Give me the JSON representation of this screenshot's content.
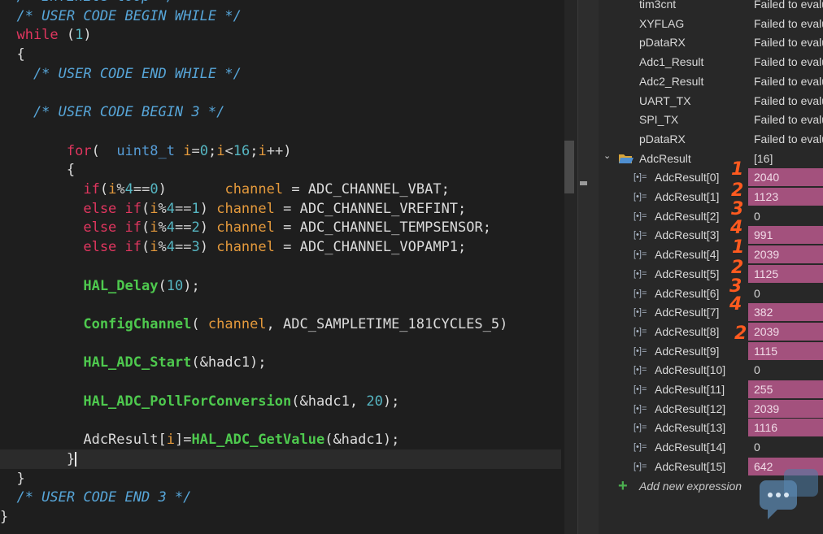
{
  "editor": {
    "lines": [
      [
        {
          "c": "cm",
          "t": "  /* Infinite loop */"
        }
      ],
      [
        {
          "c": "cm",
          "t": "  /* USER CODE BEGIN WHILE */"
        }
      ],
      [
        {
          "c": "kw",
          "t": "  while"
        },
        {
          "c": "pl",
          "t": " ("
        },
        {
          "c": "num",
          "t": "1"
        },
        {
          "c": "pl",
          "t": ")"
        }
      ],
      [
        {
          "c": "pl",
          "t": "  {"
        }
      ],
      [
        {
          "c": "cm",
          "t": "    /* USER CODE END WHILE */"
        }
      ],
      [],
      [
        {
          "c": "cm",
          "t": "    /* USER CODE BEGIN 3 */"
        }
      ],
      [],
      [
        {
          "c": "kw",
          "t": "        for"
        },
        {
          "c": "pl",
          "t": "(  "
        },
        {
          "c": "ty",
          "t": "uint8_t"
        },
        {
          "c": "pl",
          "t": " "
        },
        {
          "c": "var",
          "t": "i"
        },
        {
          "c": "op",
          "t": "="
        },
        {
          "c": "num",
          "t": "0"
        },
        {
          "c": "pl",
          "t": ";"
        },
        {
          "c": "var",
          "t": "i"
        },
        {
          "c": "op",
          "t": "<"
        },
        {
          "c": "num",
          "t": "16"
        },
        {
          "c": "pl",
          "t": ";"
        },
        {
          "c": "var",
          "t": "i"
        },
        {
          "c": "op",
          "t": "++"
        },
        {
          "c": "pl",
          "t": ")"
        }
      ],
      [
        {
          "c": "pl",
          "t": "        {"
        }
      ],
      [
        {
          "c": "kw",
          "t": "          if"
        },
        {
          "c": "pl",
          "t": "("
        },
        {
          "c": "var",
          "t": "i"
        },
        {
          "c": "op",
          "t": "%"
        },
        {
          "c": "num",
          "t": "4"
        },
        {
          "c": "op",
          "t": "=="
        },
        {
          "c": "num",
          "t": "0"
        },
        {
          "c": "pl",
          "t": ")       "
        },
        {
          "c": "var",
          "t": "channel"
        },
        {
          "c": "pl",
          "t": " = ADC_CHANNEL_VBAT;"
        }
      ],
      [
        {
          "c": "kw",
          "t": "          else if"
        },
        {
          "c": "pl",
          "t": "("
        },
        {
          "c": "var",
          "t": "i"
        },
        {
          "c": "op",
          "t": "%"
        },
        {
          "c": "num",
          "t": "4"
        },
        {
          "c": "op",
          "t": "=="
        },
        {
          "c": "num",
          "t": "1"
        },
        {
          "c": "pl",
          "t": ") "
        },
        {
          "c": "var",
          "t": "channel"
        },
        {
          "c": "pl",
          "t": " = ADC_CHANNEL_VREFINT;"
        }
      ],
      [
        {
          "c": "kw",
          "t": "          else if"
        },
        {
          "c": "pl",
          "t": "("
        },
        {
          "c": "var",
          "t": "i"
        },
        {
          "c": "op",
          "t": "%"
        },
        {
          "c": "num",
          "t": "4"
        },
        {
          "c": "op",
          "t": "=="
        },
        {
          "c": "num",
          "t": "2"
        },
        {
          "c": "pl",
          "t": ") "
        },
        {
          "c": "var",
          "t": "channel"
        },
        {
          "c": "pl",
          "t": " = ADC_CHANNEL_TEMPSENSOR;"
        }
      ],
      [
        {
          "c": "kw",
          "t": "          else if"
        },
        {
          "c": "pl",
          "t": "("
        },
        {
          "c": "var",
          "t": "i"
        },
        {
          "c": "op",
          "t": "%"
        },
        {
          "c": "num",
          "t": "4"
        },
        {
          "c": "op",
          "t": "=="
        },
        {
          "c": "num",
          "t": "3"
        },
        {
          "c": "pl",
          "t": ") "
        },
        {
          "c": "var",
          "t": "channel"
        },
        {
          "c": "pl",
          "t": " = ADC_CHANNEL_VOPAMP1;"
        }
      ],
      [],
      [
        {
          "c": "fn",
          "t": "          HAL_Delay"
        },
        {
          "c": "pl",
          "t": "("
        },
        {
          "c": "num",
          "t": "10"
        },
        {
          "c": "pl",
          "t": ");"
        }
      ],
      [],
      [
        {
          "c": "fn",
          "t": "          ConfigChannel"
        },
        {
          "c": "pl",
          "t": "( "
        },
        {
          "c": "var",
          "t": "channel"
        },
        {
          "c": "pl",
          "t": ", ADC_SAMPLETIME_181CYCLES_5)"
        }
      ],
      [],
      [
        {
          "c": "fn",
          "t": "          HAL_ADC_Start"
        },
        {
          "c": "pl",
          "t": "(&hadc1);"
        }
      ],
      [],
      [
        {
          "c": "fn",
          "t": "          HAL_ADC_PollForConversion"
        },
        {
          "c": "pl",
          "t": "(&hadc1, "
        },
        {
          "c": "num",
          "t": "20"
        },
        {
          "c": "pl",
          "t": ");"
        }
      ],
      [],
      [
        {
          "c": "pl",
          "t": "          AdcResult["
        },
        {
          "c": "var",
          "t": "i"
        },
        {
          "c": "pl",
          "t": "]="
        },
        {
          "c": "fn",
          "t": "HAL_ADC_GetValue"
        },
        {
          "c": "pl",
          "t": "(&hadc1);"
        }
      ],
      [
        {
          "c": "pl",
          "t": "        }"
        }
      ],
      [
        {
          "c": "pl",
          "t": "  }"
        }
      ],
      [
        {
          "c": "cm",
          "t": "  /* USER CODE END 3 */"
        }
      ],
      [
        {
          "c": "pl",
          "t": "}"
        }
      ]
    ]
  },
  "watch": {
    "top_rows": [
      {
        "name": "tim3cnt",
        "value": "Failed to evaluate"
      },
      {
        "name": "XYFLAG",
        "value": "Failed to evaluate"
      },
      {
        "name": "pDataRX",
        "value": "Failed to evaluate"
      },
      {
        "name": "Adc1_Result",
        "value": "Failed to evaluate"
      },
      {
        "name": "Adc2_Result",
        "value": "Failed to evaluate"
      },
      {
        "name": "UART_TX",
        "value": "Failed to evaluate"
      },
      {
        "name": "SPI_TX",
        "value": "Failed to evaluate"
      },
      {
        "name": "pDataRX",
        "value": "Failed to evaluate"
      }
    ],
    "parent": {
      "name": "AdcResult",
      "value": "[16]"
    },
    "elements": [
      {
        "name": "AdcResult[0]",
        "value": "2040",
        "changed": true
      },
      {
        "name": "AdcResult[1]",
        "value": "1123",
        "changed": true
      },
      {
        "name": "AdcResult[2]",
        "value": "0",
        "changed": false
      },
      {
        "name": "AdcResult[3]",
        "value": "991",
        "changed": true
      },
      {
        "name": "AdcResult[4]",
        "value": "2039",
        "changed": true
      },
      {
        "name": "AdcResult[5]",
        "value": "1125",
        "changed": true
      },
      {
        "name": "AdcResult[6]",
        "value": "0",
        "changed": false
      },
      {
        "name": "AdcResult[7]",
        "value": "382",
        "changed": true
      },
      {
        "name": "AdcResult[8]",
        "value": "2039",
        "changed": true
      },
      {
        "name": "AdcResult[9]",
        "value": "1115",
        "changed": true
      },
      {
        "name": "AdcResult[10]",
        "value": "0",
        "changed": false
      },
      {
        "name": "AdcResult[11]",
        "value": "255",
        "changed": true
      },
      {
        "name": "AdcResult[12]",
        "value": "2039",
        "changed": true
      },
      {
        "name": "AdcResult[13]",
        "value": "1116",
        "changed": true
      },
      {
        "name": "AdcResult[14]",
        "value": "0",
        "changed": false
      },
      {
        "name": "AdcResult[15]",
        "value": "642",
        "changed": true
      }
    ],
    "add_label": "Add new expression"
  },
  "annotations": [
    "1",
    "2",
    "3",
    "4",
    "1",
    "2",
    "3",
    "4",
    "2"
  ],
  "colors": {
    "changed_value": "#a3517d",
    "annotation": "#ff5a1f"
  }
}
